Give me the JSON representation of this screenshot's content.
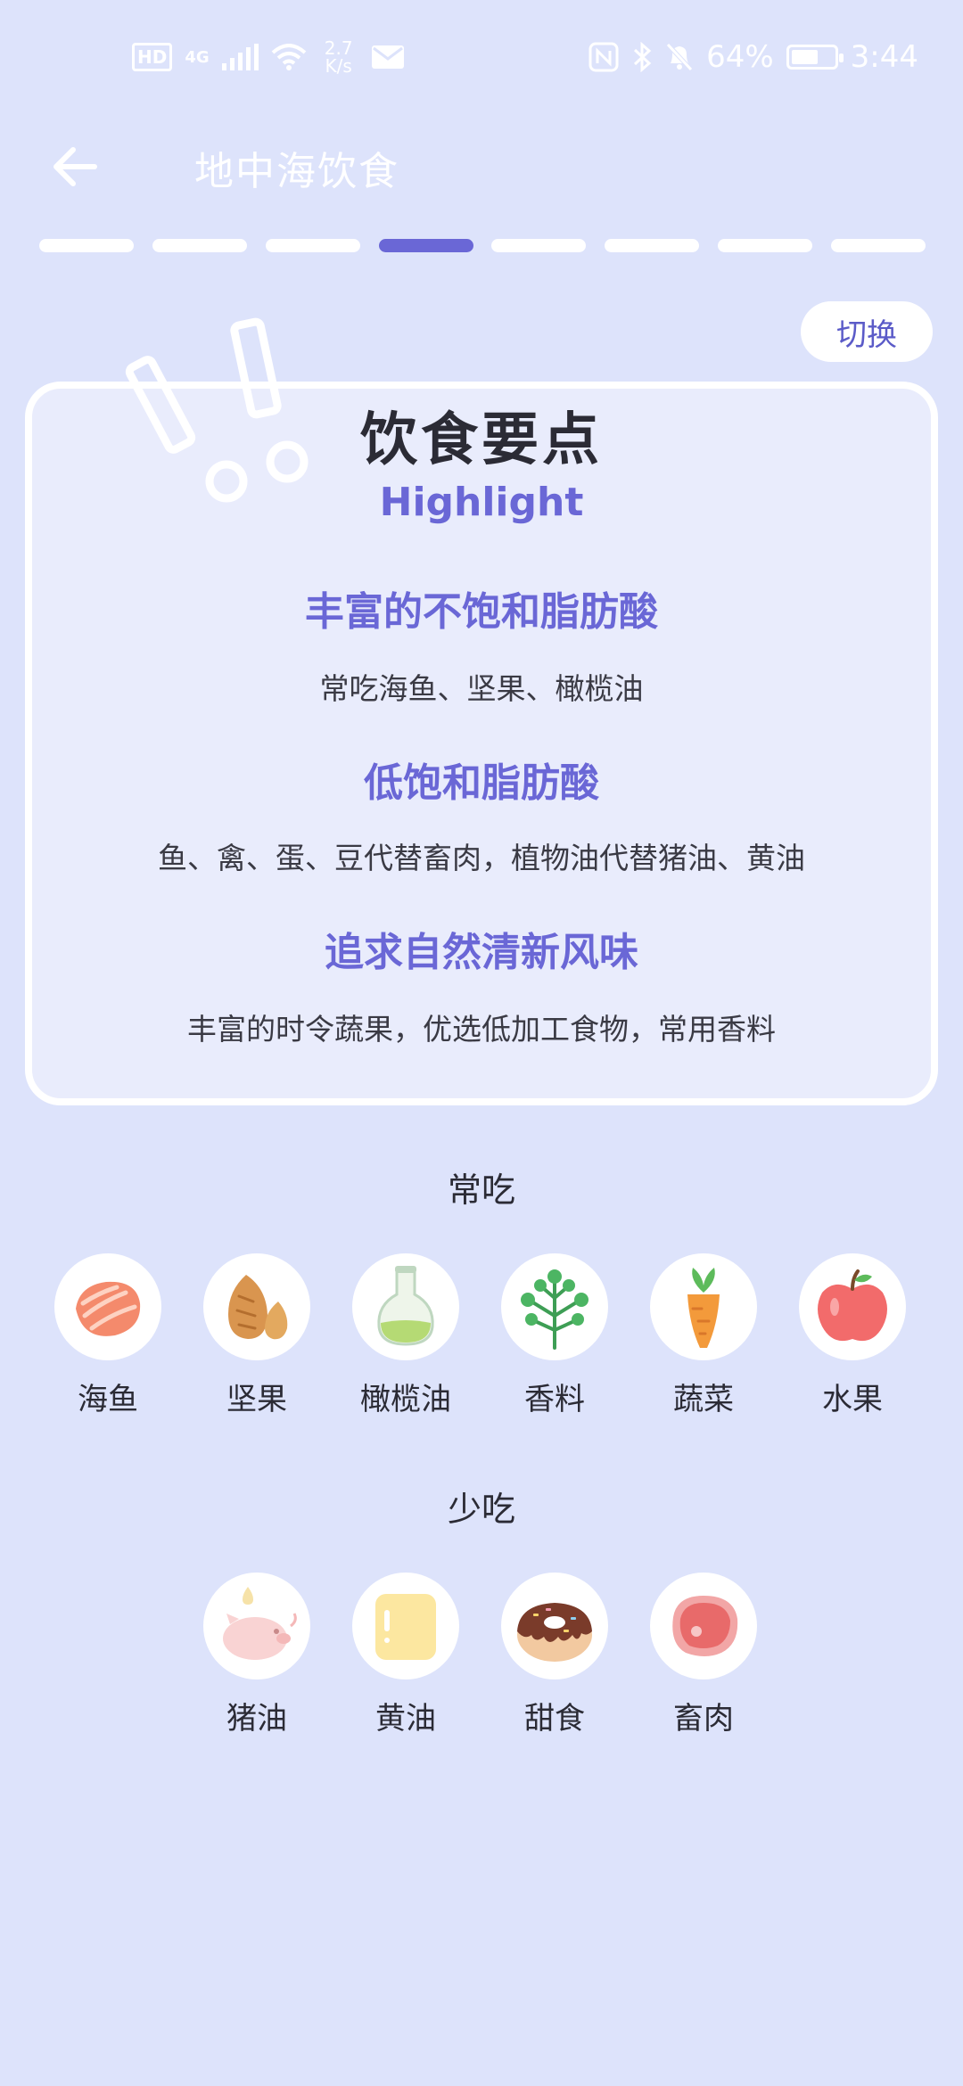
{
  "status_bar": {
    "hd": "HD",
    "network": "4G",
    "speed_value": "2.7",
    "speed_unit": "K/s",
    "battery": "64%",
    "battery_level": 0.64,
    "time": "3:44"
  },
  "app_bar": {
    "title": "地中海饮食"
  },
  "progress": {
    "total": 8,
    "current": 4
  },
  "switch_label": "切换",
  "card": {
    "title": "饮食要点",
    "subtitle": "Highlight",
    "points": [
      {
        "heading": "丰富的不饱和脂肪酸",
        "text": "常吃海鱼、坚果、橄榄油"
      },
      {
        "heading": "低饱和脂肪酸",
        "text": "鱼、禽、蛋、豆代替畜肉，植物油代替猪油、黄油"
      },
      {
        "heading": "追求自然清新风味",
        "text": "丰富的时令蔬果，优选低加工食物，常用香料"
      }
    ]
  },
  "eat_often": {
    "title": "常吃",
    "items": [
      {
        "label": "海鱼",
        "icon": "fish-icon"
      },
      {
        "label": "坚果",
        "icon": "nuts-icon"
      },
      {
        "label": "橄榄油",
        "icon": "olive-oil-icon"
      },
      {
        "label": "香料",
        "icon": "herbs-icon"
      },
      {
        "label": "蔬菜",
        "icon": "carrot-icon"
      },
      {
        "label": "水果",
        "icon": "apple-icon"
      }
    ]
  },
  "eat_less": {
    "title": "少吃",
    "items": [
      {
        "label": "猪油",
        "icon": "lard-icon"
      },
      {
        "label": "黄油",
        "icon": "butter-icon"
      },
      {
        "label": "甜食",
        "icon": "donut-icon"
      },
      {
        "label": "畜肉",
        "icon": "meat-icon"
      }
    ]
  },
  "colors": {
    "background": "#DDE3FB",
    "accent": "#6A67D6",
    "card_border": "#FFFFFF"
  }
}
